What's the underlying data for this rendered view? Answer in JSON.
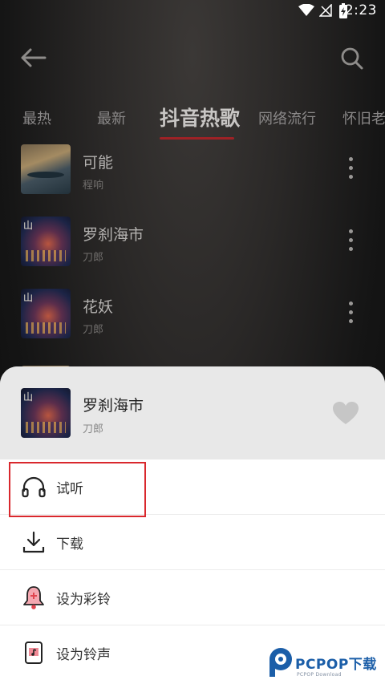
{
  "status_bar": {
    "time": "2:23"
  },
  "tabs": [
    {
      "label": "最热"
    },
    {
      "label": "最新"
    },
    {
      "label": "抖音热歌"
    },
    {
      "label": "网络流行"
    },
    {
      "label": "怀旧老"
    }
  ],
  "songs": [
    {
      "title": "可能",
      "artist": "程响"
    },
    {
      "title": "罗刹海市",
      "artist": "刀郎"
    },
    {
      "title": "花妖",
      "artist": "刀郎"
    }
  ],
  "sheet": {
    "title": "罗刹海市",
    "artist": "刀郎",
    "actions": [
      {
        "label": "试听",
        "icon": "headphones-icon"
      },
      {
        "label": "下载",
        "icon": "download-icon"
      },
      {
        "label": "设为彩铃",
        "icon": "bell-icon"
      },
      {
        "label": "设为铃声",
        "icon": "phone-ringtone-icon"
      }
    ]
  },
  "watermark": {
    "brand": "PCPOP下载",
    "sub": "PCPOP Download"
  },
  "colors": {
    "accent": "#9e2226",
    "highlight_box": "#d9282d",
    "watermark_blue": "#1b5ea8"
  }
}
